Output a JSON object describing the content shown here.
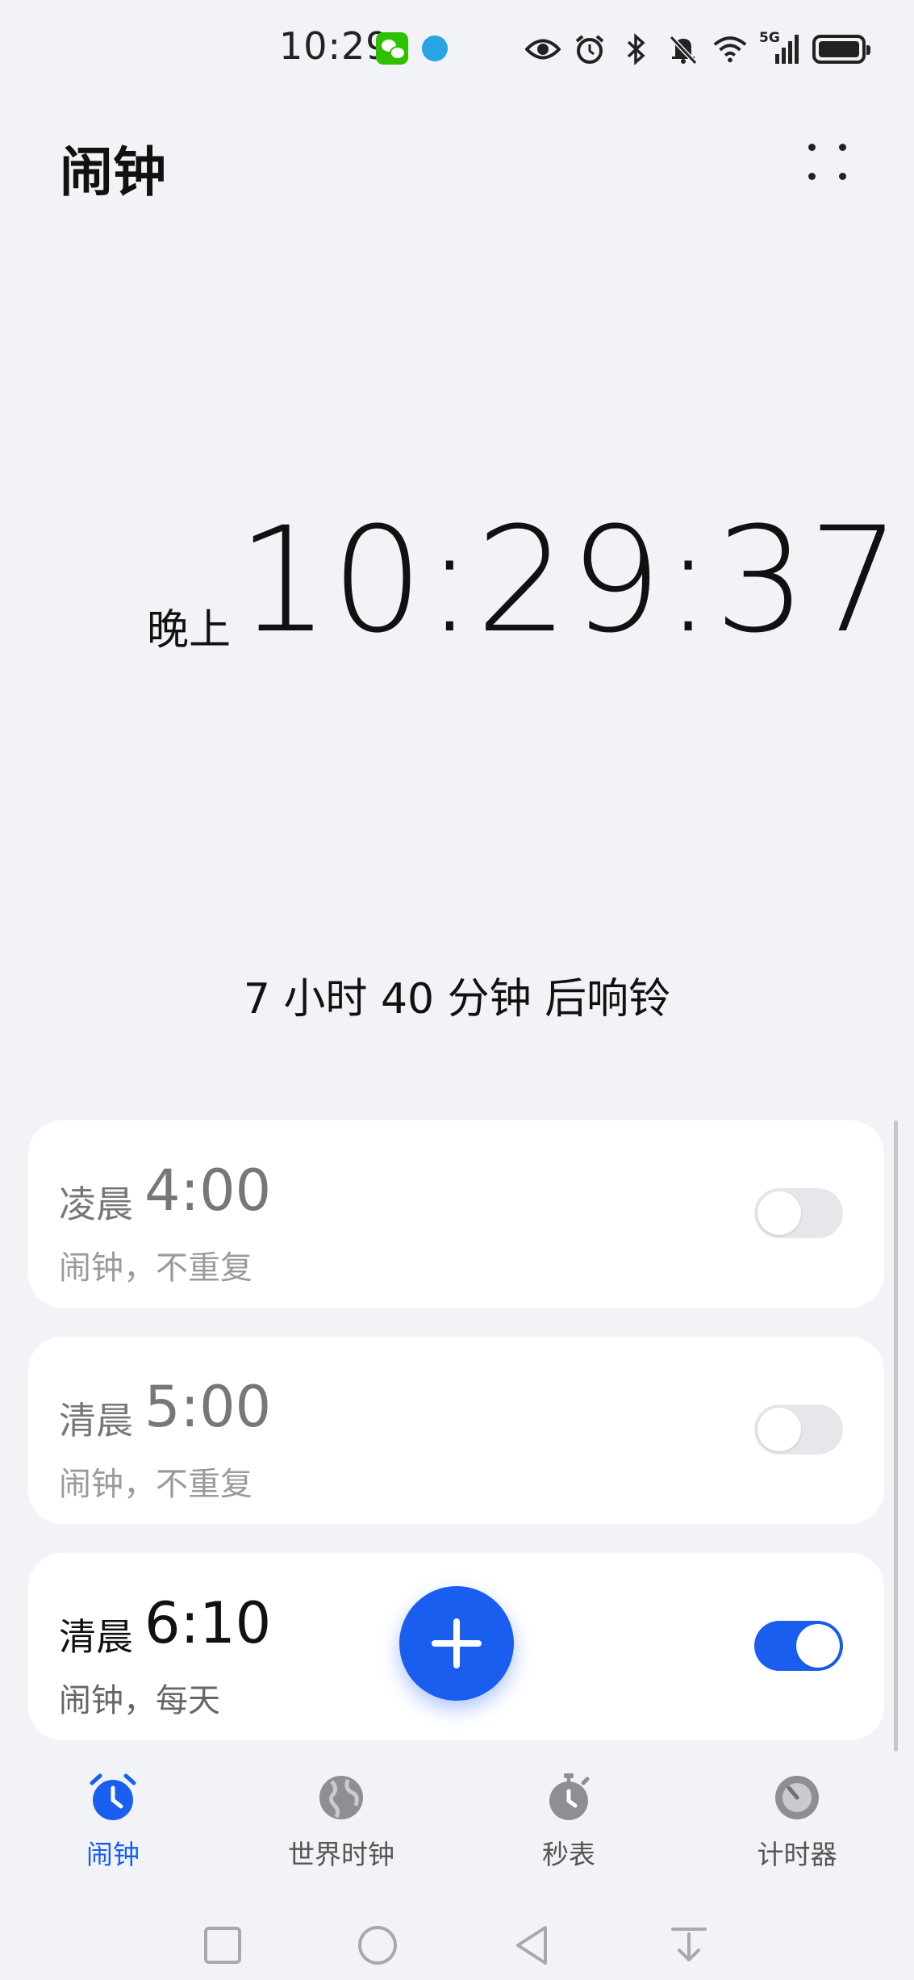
{
  "status_bar": {
    "time": "10:29",
    "network": "5G",
    "icons": [
      "wechat-icon",
      "app-notification-icon",
      "eye-icon",
      "alarm-icon",
      "bluetooth-icon",
      "mute-bell-icon",
      "wifi-icon",
      "cellular-signal-icon",
      "battery-icon"
    ]
  },
  "header": {
    "title": "闹钟"
  },
  "clock": {
    "period": "晚上",
    "time": "10:29:37"
  },
  "next_ring_text": "7 小时 40 分钟 后响铃",
  "alarms": [
    {
      "period": "凌晨",
      "time": "4:00",
      "description": "闹钟，不重复",
      "enabled": false
    },
    {
      "period": "清晨",
      "time": "5:00",
      "description": "闹钟，不重复",
      "enabled": false
    },
    {
      "period": "清晨",
      "time": "6:10",
      "description": "闹钟，每天",
      "enabled": true
    }
  ],
  "bottom_nav": [
    {
      "label": "闹钟",
      "active": true
    },
    {
      "label": "世界时钟",
      "active": false
    },
    {
      "label": "秒表",
      "active": false
    },
    {
      "label": "计时器",
      "active": false
    }
  ],
  "colors": {
    "accent": "#1a5eef",
    "background": "#f1f3f6",
    "card": "#ffffff"
  }
}
